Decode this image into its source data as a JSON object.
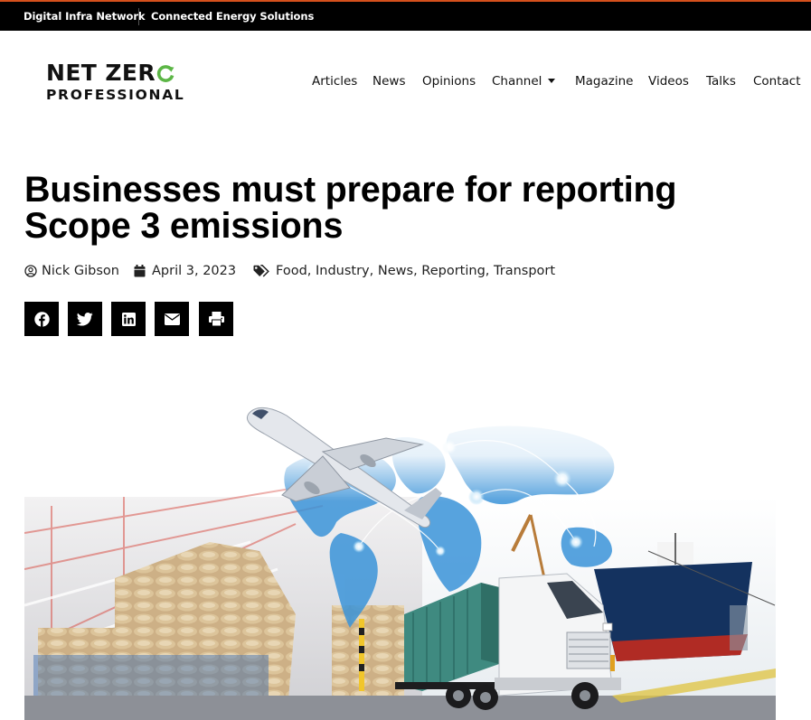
{
  "topbar": {
    "link1": "Digital Infra Network",
    "link2": "Connected Energy Solutions"
  },
  "logo": {
    "line1": "NET ZER",
    "line2": "PROFESSIONAL",
    "accent_color": "#5cb646"
  },
  "nav": {
    "articles": "Articles",
    "news": "News",
    "opinions": "Opinions",
    "channel": "Channel",
    "magazine": "Magazine",
    "videos": "Videos",
    "talks": "Talks",
    "contact": "Contact"
  },
  "article": {
    "title_line1": "Businesses must prepare for reporting",
    "title_line2": "Scope 3 emissions",
    "author": "Nick Gibson",
    "date": "April 3, 2023",
    "tags": [
      "Food",
      "Industry",
      "News",
      "Reporting",
      "Transport"
    ]
  },
  "share": {
    "icons": [
      "facebook-icon",
      "twitter-icon",
      "linkedin-icon",
      "email-icon",
      "print-icon"
    ]
  },
  "colors": {
    "topbar_bg": "#000000",
    "topbar_accent": "#d4501c",
    "share_bg": "#000000"
  }
}
